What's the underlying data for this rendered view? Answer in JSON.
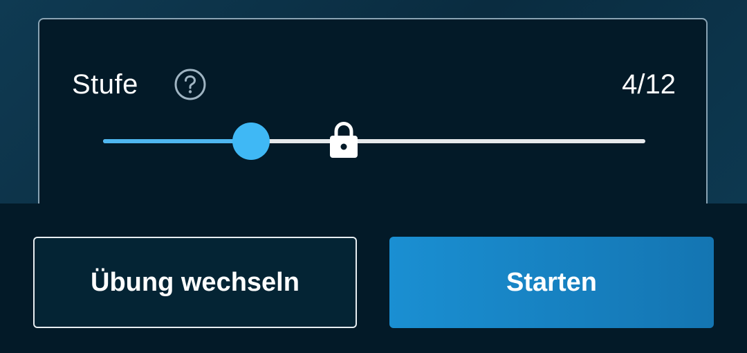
{
  "level": {
    "label": "Stufe",
    "value_text": "4/12",
    "current": 4,
    "max": 12,
    "slider_fraction": 0.273,
    "lock_fraction": 0.444
  },
  "icons": {
    "help": "question-circle-icon",
    "lock": "lock-icon"
  },
  "buttons": {
    "switch_label": "Übung wechseln",
    "start_label": "Starten"
  },
  "colors": {
    "accent": "#3fb8f5",
    "primary_button": "#1a8fd2",
    "panel_background": "#031a28"
  }
}
